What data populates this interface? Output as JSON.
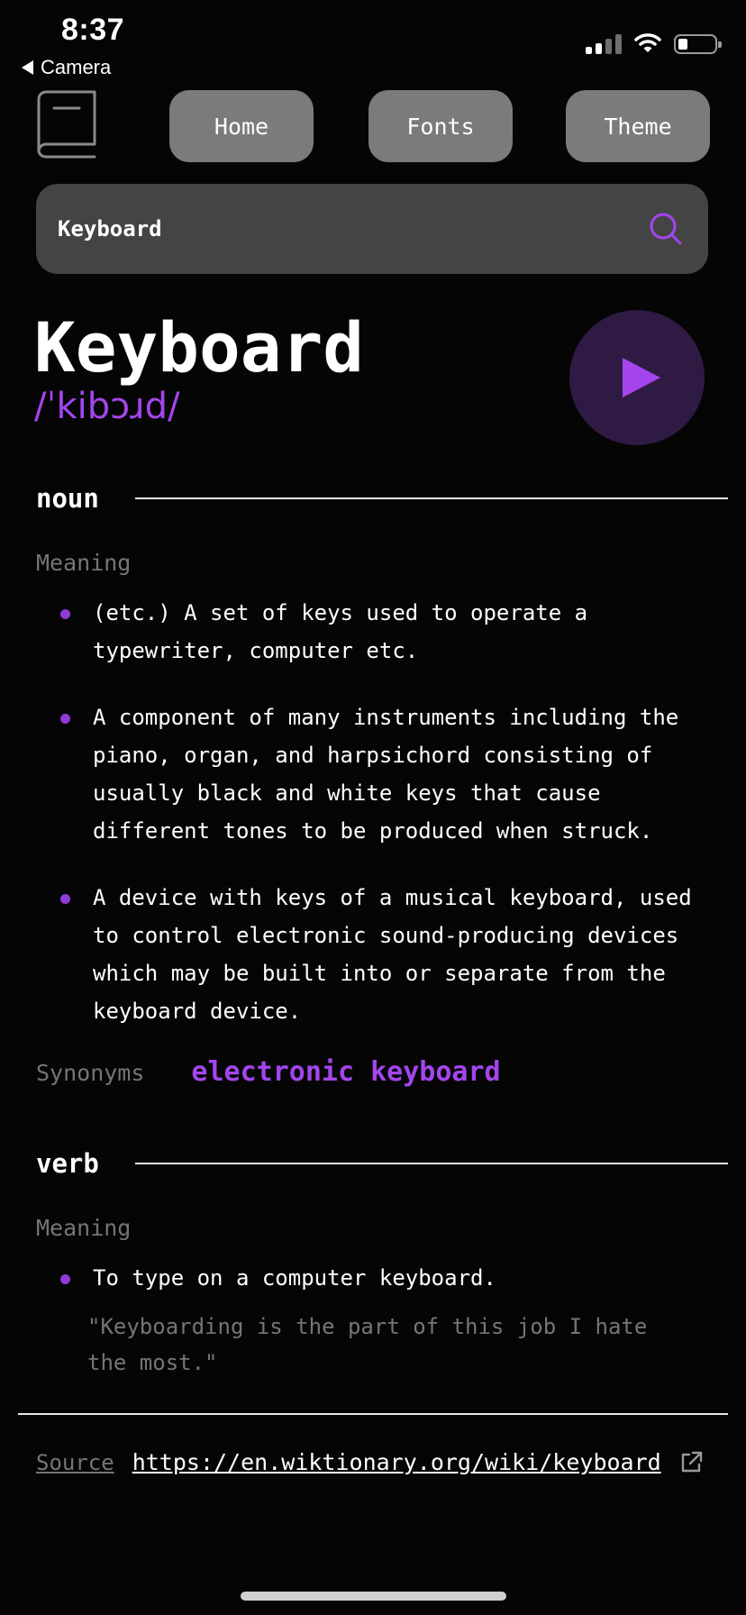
{
  "status_bar": {
    "time": "8:37",
    "back_label": "Camera"
  },
  "nav": {
    "home": "Home",
    "fonts": "Fonts",
    "theme": "Theme"
  },
  "search": {
    "value": "Keyboard"
  },
  "word": {
    "title": "Keyboard",
    "phonetic": "/ˈkibɔɹd/"
  },
  "noun": {
    "label": "noun",
    "meaning_label": "Meaning",
    "definitions": [
      "(etc.) A set of keys used to operate a typewriter, computer etc.",
      "A component of many instruments including the piano, organ, and harpsichord consisting of usually black and white keys that cause different tones to be produced when struck.",
      "A device with keys of a musical keyboard, used to control electronic sound-producing devices which may be built into or separate from the keyboard device."
    ],
    "synonyms_label": "Synonyms",
    "synonym": "electronic keyboard"
  },
  "verb": {
    "label": "verb",
    "meaning_label": "Meaning",
    "definitions": [
      "To type on a computer keyboard."
    ],
    "example": "\"Keyboarding is the part of this job I hate the most.\""
  },
  "source": {
    "label": "Source",
    "url": "https://en.wiktionary.org/wiki/keyboard"
  },
  "colors": {
    "accent": "#a445ed",
    "background": "#050505",
    "muted": "#757575",
    "button": "#7b7b7b",
    "search_bg": "#444444"
  },
  "icons": {
    "logo": "book-icon",
    "search": "search-icon",
    "play": "play-icon",
    "external": "external-link-icon"
  }
}
